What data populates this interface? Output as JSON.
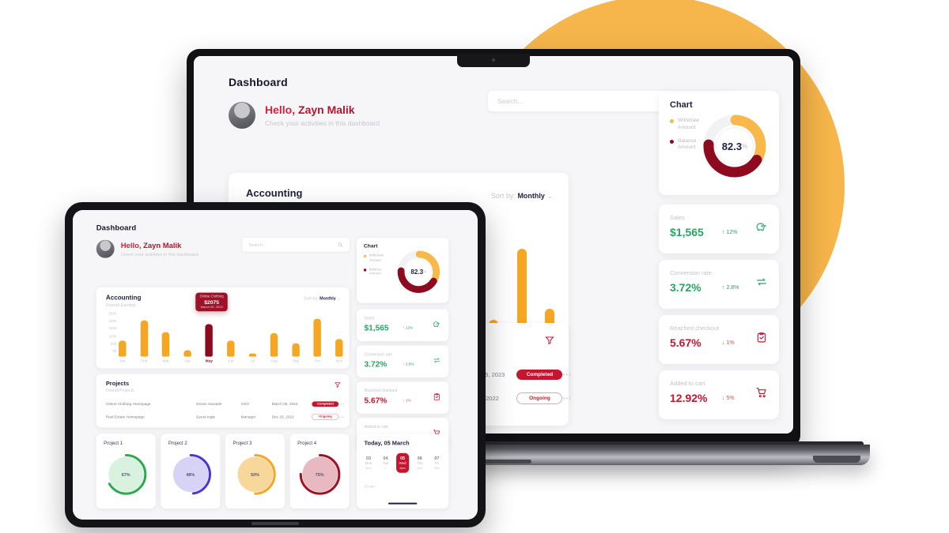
{
  "brand": {
    "orange": "#F5A623",
    "red": "#C4162F",
    "dark_red": "#8E0B1F",
    "green": "#25A662",
    "bg_circle": "#F7B64B"
  },
  "header": {
    "page_title": "Dashboard",
    "greeting_prefix": "Hello,",
    "user_name": "Zayn Malik",
    "greeting_sub": "Check your activities in this dashboard"
  },
  "search": {
    "placeholder": "Search...",
    "icon": "search-icon"
  },
  "accounting": {
    "title": "Accounting",
    "subtitle": "Overall Earning",
    "sort_prefix": "Sort by:",
    "sort_value": "Monthly",
    "tooltip": {
      "label": "Online Clothing",
      "amount": "$2075",
      "date": "March 05, 2023"
    }
  },
  "chart_data": {
    "type": "bar",
    "title": "Accounting",
    "subtitle": "Overall Earning",
    "xlabel": "",
    "ylabel": "",
    "ylim": [
      0,
      2500
    ],
    "yticks": [
      "2500",
      "2000",
      "1500",
      "1000",
      "500",
      "50"
    ],
    "categories": [
      "Jan",
      "Feb",
      "Mar",
      "Apr",
      "May",
      "Jun",
      "Jul",
      "Aug",
      "Sep",
      "Oct",
      "Nov"
    ],
    "values": [
      1000,
      2300,
      1550,
      400,
      2075,
      1000,
      200,
      1500,
      850,
      2400,
      1100
    ],
    "highlight_index": 4,
    "highlight_color": "#8E0B1F",
    "bar_color": "#F5A623",
    "grid": false,
    "legend": "none"
  },
  "donut_chart": {
    "title": "Chart",
    "type": "pie",
    "center_value": "82.3",
    "center_unit": "%",
    "legend": [
      {
        "label": "Withdraw Amount",
        "color": "#F8B84A",
        "value": 40
      },
      {
        "label": "Balance Amount",
        "color": "#8E0B1F",
        "value": 42
      }
    ]
  },
  "stats": [
    {
      "name": "sales",
      "label": "Sales",
      "value": "$1,565",
      "delta": "12%",
      "direction": "up",
      "icon": "piggy-bank-icon",
      "tone": "green"
    },
    {
      "name": "conversion-rate",
      "label": "Conversion rate",
      "value": "3.72%",
      "delta": "2.8%",
      "direction": "up",
      "icon": "exchange-icon",
      "tone": "green"
    },
    {
      "name": "reached-checkout",
      "label": "Reached checkout",
      "value": "5.67%",
      "delta": "1%",
      "direction": "down",
      "icon": "clipboard-check-icon",
      "tone": "red"
    },
    {
      "name": "added-to-cart",
      "label": "Added to cart",
      "value": "12.92%",
      "delta": "5%",
      "direction": "down",
      "icon": "shopping-cart-icon",
      "tone": "red"
    }
  ],
  "projects": {
    "title": "Projects",
    "subtitle": "Overall Projects",
    "filter_icon": "filter-icon",
    "rows": [
      {
        "name": "Online Clothing Homepage",
        "person": "Sriram Sarvade",
        "role": "CEO",
        "date": "March 05, 2023",
        "status": "Completed",
        "menu": "more-options-icon"
      },
      {
        "name": "Real Estate Homepage",
        "person": "Geeta Ingle",
        "role": "Manager",
        "date": "Dec 25, 2022",
        "status": "Ongoing",
        "menu": "more-options-icon"
      }
    ]
  },
  "project_cards": [
    {
      "title": "Project 1",
      "percent": "67%",
      "value": 67,
      "color": "#2FA84F",
      "fill": "#D9F2DF"
    },
    {
      "title": "Project 2",
      "percent": "48%",
      "value": 48,
      "color": "#4A36D6",
      "fill": "#D7D3F7"
    },
    {
      "title": "Project 3",
      "percent": "50%",
      "value": 50,
      "color": "#F5A623",
      "fill": "#F8D79B"
    },
    {
      "title": "Project 4",
      "percent": "75%",
      "value": 75,
      "color": "#9E1126",
      "fill": "#E8B9C0"
    }
  ],
  "calendar": {
    "title": "Today, 05 March",
    "days": [
      {
        "num": "03",
        "wd": "Mon",
        "sub": "4pm",
        "active": false
      },
      {
        "num": "04",
        "wd": "Tue",
        "sub": "•",
        "active": false
      },
      {
        "num": "05",
        "wd": "Wed",
        "sub": "6pm",
        "active": true
      },
      {
        "num": "06",
        "wd": "Thu",
        "sub": "4pm",
        "active": false
      },
      {
        "num": "07",
        "wd": "Fri",
        "sub": "4pm",
        "active": false
      }
    ],
    "footer": "13 am"
  }
}
